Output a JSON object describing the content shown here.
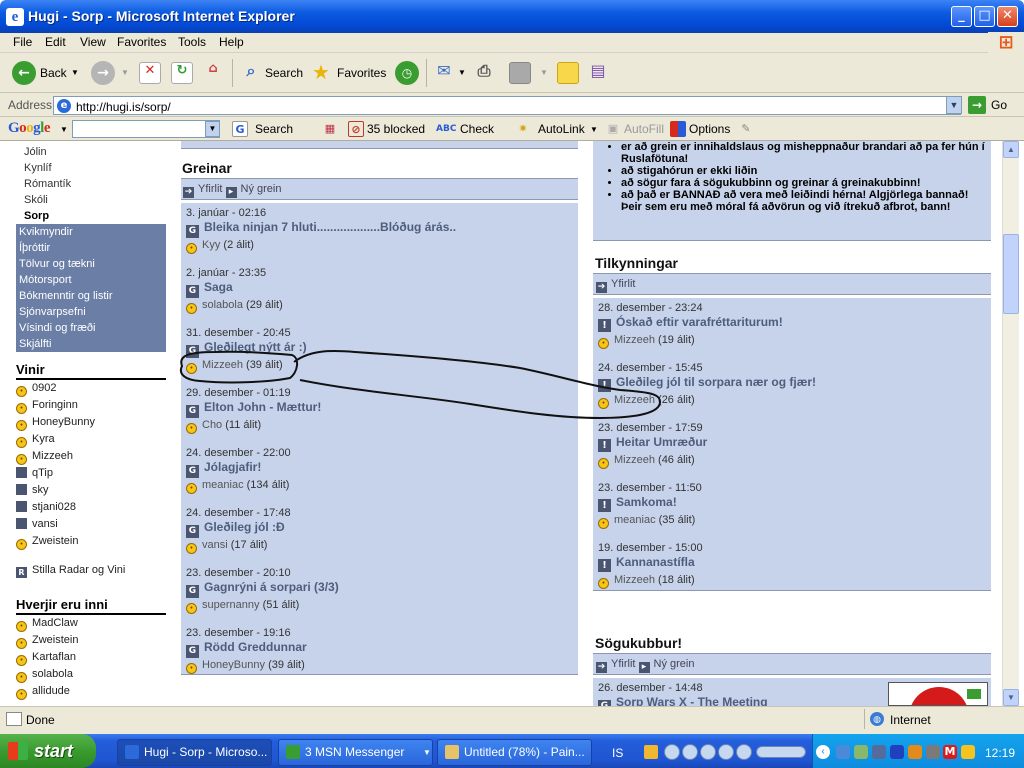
{
  "window": {
    "title": "Hugi - Sorp - Microsoft Internet Explorer"
  },
  "menu": [
    "File",
    "Edit",
    "View",
    "Favorites",
    "Tools",
    "Help"
  ],
  "toolbar": {
    "back": "Back",
    "search": "Search",
    "favorites": "Favorites"
  },
  "address": {
    "label": "Address",
    "url": "http://hugi.is/sorp/",
    "go": "Go"
  },
  "google": {
    "logo": "Google",
    "search": "Search",
    "blocked": "35 blocked",
    "check": "Check",
    "autolink": "AutoLink",
    "autofill": "AutoFill",
    "options": "Options"
  },
  "status": {
    "text": "Done",
    "zone": "Internet"
  },
  "taskbar": {
    "start": "start",
    "tasks": [
      "Hugi - Sorp - Microso...",
      "3 MSN Messenger",
      "Untitled (78%) - Pain..."
    ],
    "lang": "IS",
    "clock": "12:19"
  },
  "sidebar": {
    "links": [
      "Jólin",
      "Kynlíf",
      "Rómantík",
      "Skóli",
      "Sorp"
    ],
    "categories": [
      "Kvikmyndir",
      "Íþróttir",
      "Tölvur og tækni",
      "Mótorsport",
      "Bókmenntir og listir",
      "Sjónvarpsefni",
      "Vísindi og fræði",
      "Skjálfti"
    ],
    "friends_title": "Vinir",
    "friends": [
      "0902",
      "Foringinn",
      "HoneyBunny",
      "Kyra",
      "Mizzeeh",
      "qTip",
      "sky",
      "stjani028",
      "vansi",
      "Zweistein"
    ],
    "radar": "Stilla Radar og Vini",
    "online_title": "Hverjir eru inni",
    "online": [
      "MadClaw",
      "Zweistein",
      "Kartaflan",
      "solabola",
      "allidude"
    ]
  },
  "greinar": {
    "title": "Greinar",
    "tabs": [
      "Yfirlit",
      "Ný grein"
    ],
    "posts": [
      {
        "date": "3. janúar - 02:16",
        "title": "Bleika ninjan 7 hluti...................Blóðug árás..",
        "author": "Kyy",
        "comments": "(2 álit)"
      },
      {
        "date": "2. janúar - 23:35",
        "title": "Saga",
        "author": "solabola",
        "comments": "(29 álit)"
      },
      {
        "date": "31. desember - 20:45",
        "title": "Gleðilegt nýtt ár :)",
        "author": "Mizzeeh",
        "comments": "(39 álit)"
      },
      {
        "date": "29. desember - 01:19",
        "title": "Elton John - Mættur!",
        "author": "Cho",
        "comments": "(11 álit)"
      },
      {
        "date": "24. desember - 22:00",
        "title": "Jólagjafir!",
        "author": "meaniac",
        "comments": "(134 álit)"
      },
      {
        "date": "24. desember - 17:48",
        "title": "Gleðileg jól :Ð",
        "author": "vansi",
        "comments": "(17 álit)"
      },
      {
        "date": "23. desember - 20:10",
        "title": "Gagnrýni á sorpari (3/3)",
        "author": "supernanny",
        "comments": "(51 álit)"
      },
      {
        "date": "23. desember - 19:16",
        "title": "Rödd Greddunnar",
        "author": "HoneyBunny",
        "comments": "(39 álit)"
      }
    ]
  },
  "rules": [
    "er að grein er innihaldslaus og misheppnaður brandari að pa fer hún í Ruslafötuna!",
    "að stigahórun er ekki liðin",
    "að sögur fara á sögukubbinn og greinar á greinakubbinn!",
    "að það er BANNAÐ að vera með leiðindi hérna! Algjörlega bannað! Þeir sem eru með móral fá aðvörun og við ítrekuð afbrot, bann!"
  ],
  "tilkynningar": {
    "title": "Tilkynningar",
    "tab": "Yfirlit",
    "posts": [
      {
        "date": "28. desember - 23:24",
        "title": "Óskað eftir varafréttariturum!",
        "author": "Mizzeeh",
        "comments": "(19 álit)"
      },
      {
        "date": "24. desember - 15:45",
        "title": "Gleðileg jól til sorpara nær og fjær!",
        "author": "Mizzeeh",
        "comments": "(26 álit)"
      },
      {
        "date": "23. desember - 17:59",
        "title": "Heitar Umræður",
        "author": "Mizzeeh",
        "comments": "(46 álit)"
      },
      {
        "date": "23. desember - 11:50",
        "title": "Samkoma!",
        "author": "meaniac",
        "comments": "(35 álit)"
      },
      {
        "date": "19. desember - 15:00",
        "title": "Kannanastífla",
        "author": "Mizzeeh",
        "comments": "(18 álit)"
      }
    ]
  },
  "sogukubbur": {
    "title": "Sögukubbur!",
    "tabs": [
      "Yfirlit",
      "Ný grein"
    ],
    "post": {
      "date": "26. desember - 14:48",
      "title": "Sorp Wars X - The Meeting"
    }
  }
}
